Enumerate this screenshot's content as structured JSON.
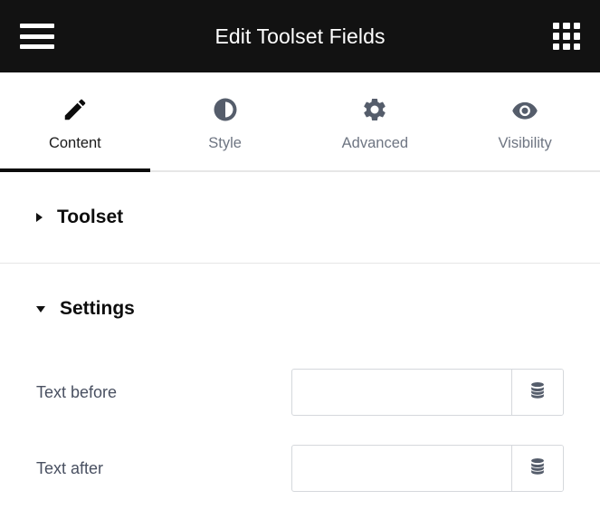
{
  "topbar": {
    "title": "Edit Toolset Fields",
    "menu_icon": "hamburger-icon",
    "apps_icon": "grid-apps-icon"
  },
  "tabs": [
    {
      "label": "Content",
      "icon": "pencil-icon",
      "active": true
    },
    {
      "label": "Style",
      "icon": "contrast-icon",
      "active": false
    },
    {
      "label": "Advanced",
      "icon": "gear-icon",
      "active": false
    },
    {
      "label": "Visibility",
      "icon": "eye-icon",
      "active": false
    }
  ],
  "sections": [
    {
      "title": "Toolset",
      "expanded": false,
      "caret": "caret-right-icon"
    },
    {
      "title": "Settings",
      "expanded": true,
      "caret": "caret-down-icon"
    }
  ],
  "settings_fields": [
    {
      "label": "Text before",
      "value": "",
      "placeholder": "",
      "addon_icon": "database-icon"
    },
    {
      "label": "Text after",
      "value": "",
      "placeholder": "",
      "addon_icon": "database-icon"
    }
  ],
  "colors": {
    "topbar_background": "#121212",
    "topbar_text": "#ffffff",
    "tab_inactive_text": "#6e7582",
    "tab_active_text": "#1a1a1a",
    "tab_icon": "#555d6b",
    "active_underline": "#0c0c0c",
    "divider": "#e6e6e6",
    "label_text": "#495061",
    "input_border": "#d5d8dc",
    "section_title": "#0d0d0d"
  }
}
